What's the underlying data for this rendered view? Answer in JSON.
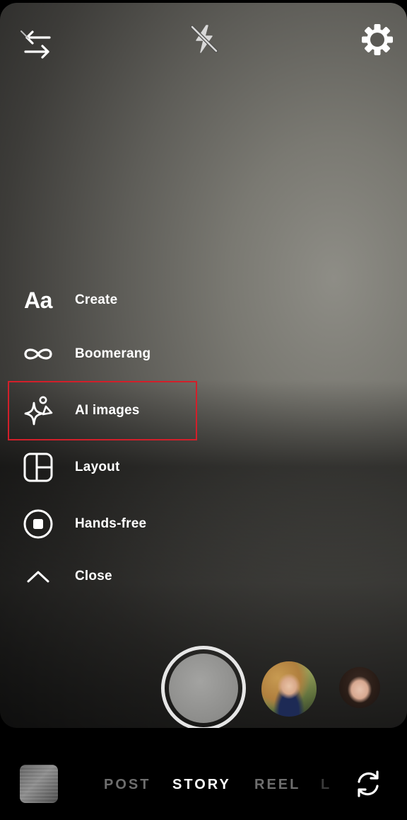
{
  "menu": {
    "create_label": "Create",
    "create_glyph": "Aa",
    "boomerang_label": "Boomerang",
    "ai_images_label": "AI images",
    "layout_label": "Layout",
    "hands_free_label": "Hands-free",
    "close_label": "Close"
  },
  "icons": {
    "top_left": "switch-arrows-icon",
    "top_center": "flash-off-icon",
    "top_right": "settings-gear-icon",
    "bottom_right": "flip-camera-icon"
  },
  "modes": {
    "post": "POST",
    "story": "STORY",
    "reel": "REEL",
    "live": "LIVE",
    "selected": "STORY"
  },
  "highlight": {
    "color": "#d21f2a",
    "target": "AI images"
  }
}
